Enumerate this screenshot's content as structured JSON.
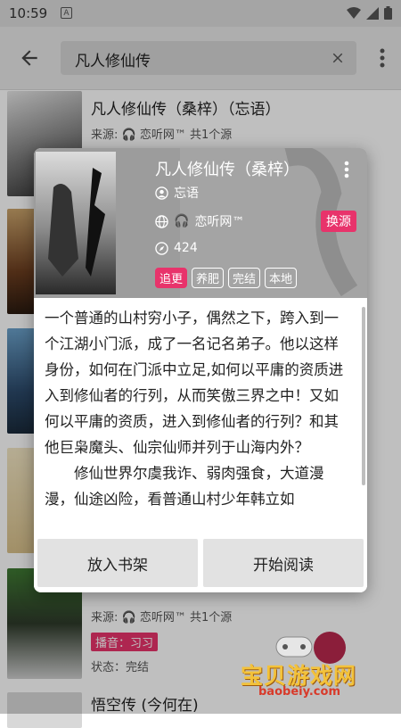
{
  "status_bar": {
    "time": "10:59",
    "notification_glyph": "A",
    "icons": [
      "wifi-icon",
      "signal-icon",
      "battery-icon"
    ]
  },
  "app_bar": {
    "search_value": "凡人修仙传"
  },
  "list": {
    "items": [
      {
        "title": "凡人修仙传（桑梓）（忘语）",
        "source_prefix": "来源:",
        "source_name": "恋听网™",
        "source_count": "共1个源"
      },
      {
        "title": "",
        "source_prefix": "来源:",
        "source_name": "恋听网™",
        "source_count": "共1个源",
        "narrator": "播音：习习",
        "status": "状态：完结"
      },
      {
        "title": "悟空传 (今何在)"
      }
    ]
  },
  "dialog": {
    "title": "凡人修仙传（桑梓）",
    "author": "忘语",
    "source": "恋听网™",
    "switch_source": "换源",
    "chapters": "424",
    "tags": [
      "追更",
      "养肥",
      "完结",
      "本地"
    ],
    "intro_1": "一个普通的山村穷小子，偶然之下，跨入到一个江湖小门派，成了一名记名弟子。他以这样身份，如何在门派中立足,如何以平庸的资质进入到修仙者的行列，从而笑傲三界之中！又如何以平庸的资质，进入到修仙者的行列？和其他巨枭魔头、仙宗仙师并列于山海内外？",
    "intro_2": "修仙世界尔虞我诈、弱肉强食，大道漫漫，仙途凶险，看普通山村少年韩立如",
    "add_to_shelf": "放入书架",
    "start_reading": "开始阅读"
  },
  "watermark": {
    "text": "宝贝游戏网",
    "url": "baobeiy.com"
  },
  "colors": {
    "accent": "#e8336b",
    "dialog_header": "#9c9c9c",
    "button": "#e2e2e2"
  }
}
